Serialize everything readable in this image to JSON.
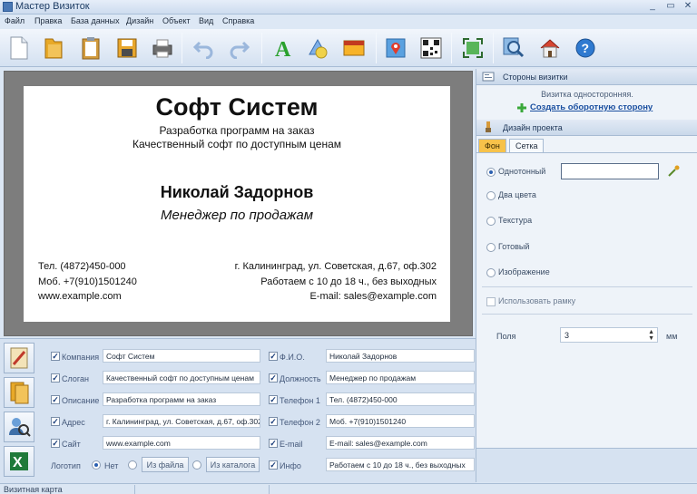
{
  "window": {
    "title": "Мастер Визиток",
    "controls": [
      "_",
      "▭",
      "✕"
    ]
  },
  "menu": [
    "Файл",
    "Правка",
    "База данных",
    "Дизайн",
    "Объект",
    "Вид",
    "Справка"
  ],
  "toolbar_icons": [
    "new-document-icon",
    "open-folder-icon",
    "clipboard-icon",
    "save-icon",
    "print-icon",
    "undo-icon",
    "redo-icon",
    "text-icon",
    "shape-icon",
    "image-icon",
    "map-marker-icon",
    "qr-code-icon",
    "fit-page-icon",
    "zoom-icon",
    "home-icon",
    "help-icon"
  ],
  "card": {
    "company": "Софт Систем",
    "description": "Разработка программ на заказ",
    "slogan": "Качественный софт по доступным ценам",
    "name": "Николай Задорнов",
    "position": "Менеджер по продажам",
    "phone1": "Тел. (4872)450-000",
    "phone2": "Моб. +7(910)1501240",
    "site": "www.example.com",
    "address": "г. Калининград, ул. Советская, д.67, оф.302",
    "hours": "Работаем с 10 до 18 ч., без выходных",
    "email": "E-mail: sales@example.com"
  },
  "panel": {
    "sides_title": "Стороны визитки",
    "sides_info": "Визитка односторонняя.",
    "create_back": "Создать оборотную сторону",
    "design_title": "Дизайн проекта",
    "tabs": [
      "Фон",
      "Сетка"
    ],
    "bg_options": [
      "Однотонный",
      "Два цвета",
      "Текстура",
      "Готовый",
      "Изображение"
    ],
    "use_frame": "Использовать рамку",
    "margins_label": "Поля",
    "margins_value": "3",
    "margins_unit": "мм"
  },
  "form": {
    "left": [
      {
        "label": "Компания",
        "value": "Софт Систем"
      },
      {
        "label": "Слоган",
        "value": "Качественный софт по доступным ценам"
      },
      {
        "label": "Описание",
        "value": "Разработка программ на заказ"
      },
      {
        "label": "Адрес",
        "value": "г. Калининград, ул. Советская, д.67, оф.302"
      },
      {
        "label": "Сайт",
        "value": "www.example.com"
      }
    ],
    "right": [
      {
        "label": "Ф.И.О.",
        "value": "Николай Задорнов"
      },
      {
        "label": "Должность",
        "value": "Менеджер по продажам"
      },
      {
        "label": "Телефон 1",
        "value": "Тел. (4872)450-000"
      },
      {
        "label": "Телефон 2",
        "value": "Моб. +7(910)1501240"
      },
      {
        "label": "E-mail",
        "value": "E-mail: sales@example.com"
      },
      {
        "label": "Инфо",
        "value": "Работаем с 10 до 18 ч., без выходных"
      }
    ],
    "logo_label": "Логотип",
    "logo_none": "Нет",
    "logo_file": "Из файла",
    "logo_catalog": "Из каталога"
  },
  "status": {
    "text": "Визитная карта"
  },
  "colors": {
    "accent": "#2a5fb0",
    "link": "#1a4fa0",
    "active_tab": "#f7c24a"
  }
}
